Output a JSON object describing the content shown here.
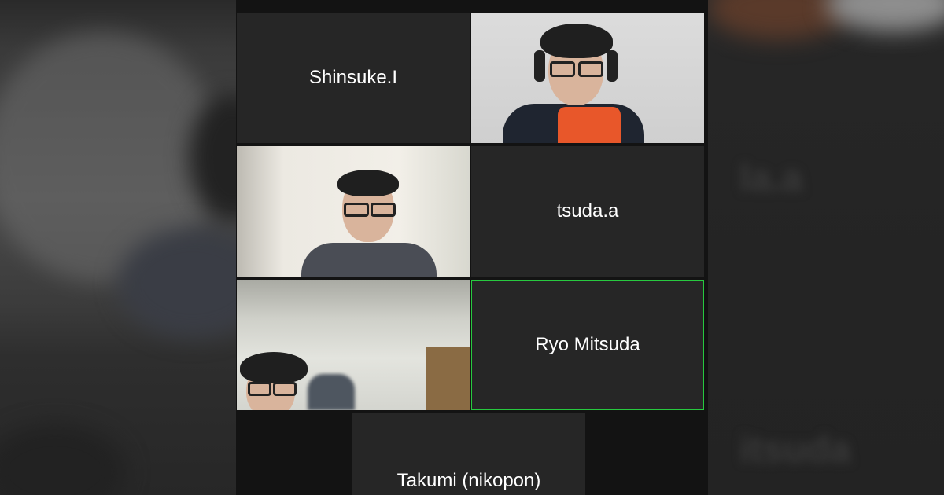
{
  "participants": [
    {
      "name": "Shinsuke.I",
      "video": false
    },
    {
      "name": "",
      "video": true
    },
    {
      "name": "",
      "video": true
    },
    {
      "name": "tsuda.a",
      "video": false
    },
    {
      "name": "",
      "video": true
    },
    {
      "name": "Ryo Mitsuda",
      "video": false,
      "active_speaker": true
    },
    {
      "name": "Takumi (nikopon)",
      "video": false
    }
  ],
  "background_blur_text": [
    "la.a",
    "itsuda"
  ],
  "colors": {
    "tile_bg": "#262626",
    "active_border": "#27c93f",
    "gallery_bg": "#131313"
  }
}
